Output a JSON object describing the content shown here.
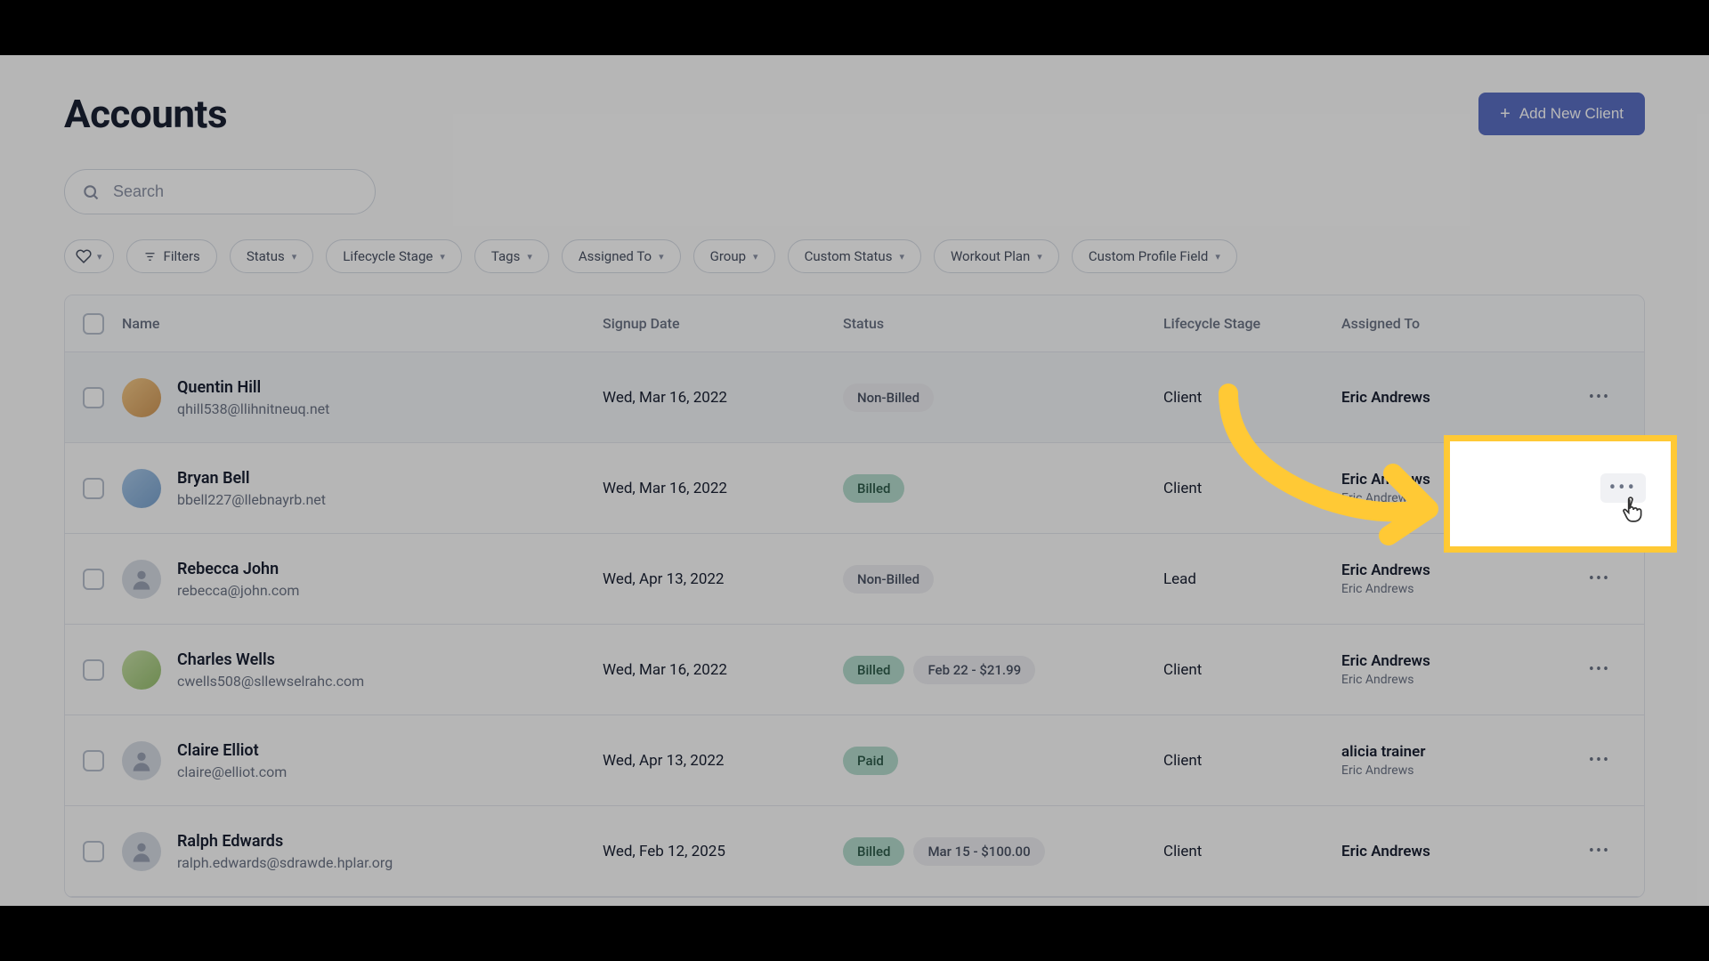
{
  "header": {
    "title": "Accounts",
    "addButton": "Add New Client"
  },
  "search": {
    "placeholder": "Search"
  },
  "filters": {
    "filtersLabel": "Filters",
    "status": "Status",
    "lifecycle": "Lifecycle Stage",
    "tags": "Tags",
    "assignedTo": "Assigned To",
    "group": "Group",
    "customStatus": "Custom Status",
    "workoutPlan": "Workout Plan",
    "customProfile": "Custom Profile Field"
  },
  "columns": {
    "name": "Name",
    "signup": "Signup Date",
    "status": "Status",
    "lifecycle": "Lifecycle Stage",
    "assigned": "Assigned To"
  },
  "rows": [
    {
      "name": "Quentin Hill",
      "email": "qhill538@llihnitneuq.net",
      "signup": "Wed, Mar 16, 2022",
      "statusLabel": "Non-Billed",
      "statusClass": "nb",
      "extra": "",
      "stage": "Client",
      "assigned": "Eric Andrews",
      "assigned2": "",
      "avatar": "photo1"
    },
    {
      "name": "Bryan Bell",
      "email": "bbell227@llebnayrb.net",
      "signup": "Wed, Mar 16, 2022",
      "statusLabel": "Billed",
      "statusClass": "billed",
      "extra": "",
      "stage": "Client",
      "assigned": "Eric Andrews",
      "assigned2": "Eric Andrews",
      "avatar": "photo2"
    },
    {
      "name": "Rebecca John",
      "email": "rebecca@john.com",
      "signup": "Wed, Apr 13, 2022",
      "statusLabel": "Non-Billed",
      "statusClass": "nb",
      "extra": "",
      "stage": "Lead",
      "assigned": "Eric Andrews",
      "assigned2": "Eric Andrews",
      "avatar": "blank"
    },
    {
      "name": "Charles Wells",
      "email": "cwells508@sllewselrahc.com",
      "signup": "Wed, Mar 16, 2022",
      "statusLabel": "Billed",
      "statusClass": "billed",
      "extra": "Feb 22 - $21.99",
      "stage": "Client",
      "assigned": "Eric Andrews",
      "assigned2": "Eric Andrews",
      "avatar": "photo4"
    },
    {
      "name": "Claire Elliot",
      "email": "claire@elliot.com",
      "signup": "Wed, Apr 13, 2022",
      "statusLabel": "Paid",
      "statusClass": "paid",
      "extra": "",
      "stage": "Client",
      "assigned": "alicia trainer",
      "assigned2": "Eric Andrews",
      "avatar": "blank"
    },
    {
      "name": "Ralph Edwards",
      "email": "ralph.edwards@sdrawde.hplar.org",
      "signup": "Wed, Feb 12, 2025",
      "statusLabel": "Billed",
      "statusClass": "billed",
      "extra": "Mar 15 - $100.00",
      "stage": "Client",
      "assigned": "Eric Andrews",
      "assigned2": "",
      "avatar": "blank"
    }
  ]
}
